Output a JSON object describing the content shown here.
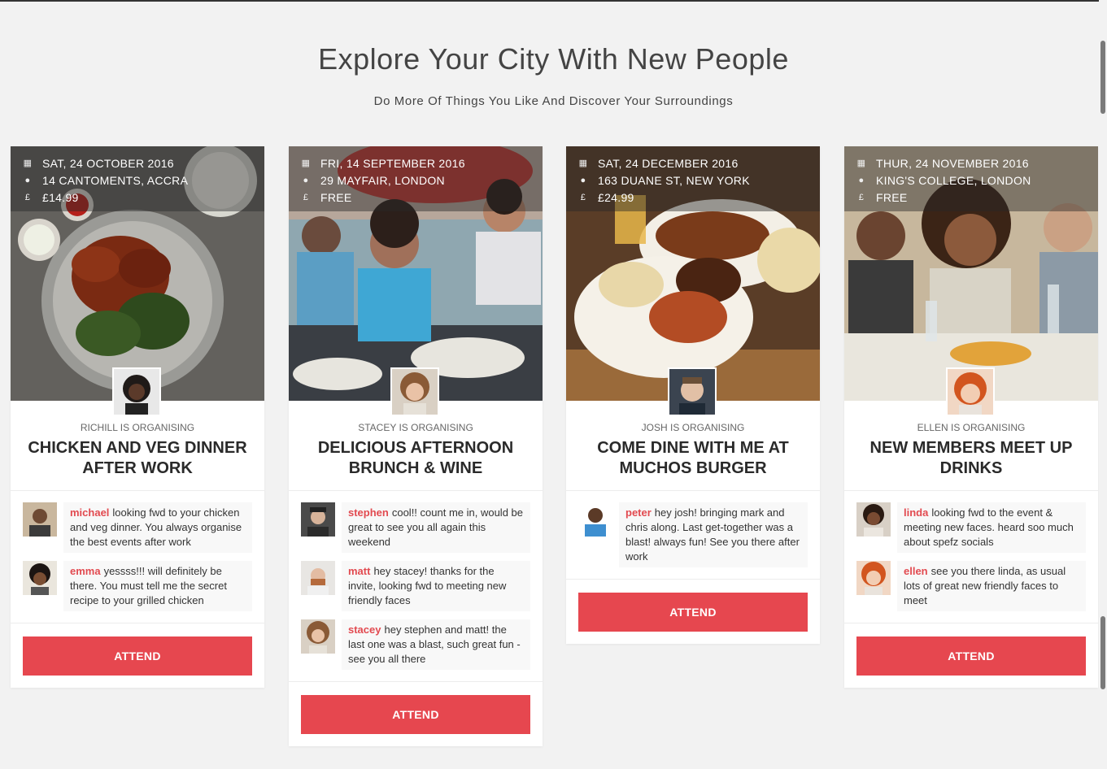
{
  "hero": {
    "title": "Explore Your City With New People",
    "subtitle": "Do More Of Things You Like And Discover Your Surroundings"
  },
  "colors": {
    "accent": "#e6474f",
    "commenter_name": "#e24a50"
  },
  "icons": {
    "date": "calendar-icon",
    "location": "map-pin-icon",
    "price": "pound-icon"
  },
  "events": [
    {
      "date": "SAT, 24 OCTOBER 2016",
      "location": "14 CANTOMENTS, ACCRA",
      "price": "£14.99",
      "organiser": "RICHILL IS ORGANISING",
      "title": "CHICKEN AND VEG DINNER AFTER WORK",
      "attend_label": "ATTEND",
      "comments": [
        {
          "name": "michael",
          "text": "looking fwd to your chicken and veg dinner. You always organise the best events after work"
        },
        {
          "name": "emma",
          "text": "yessss!!! will definitely be there. You must tell me the secret recipe to your grilled chicken"
        }
      ]
    },
    {
      "date": "FRI, 14 SEPTEMBER 2016",
      "location": "29 MAYFAIR, LONDON",
      "price": "FREE",
      "organiser": "STACEY IS ORGANISING",
      "title": "DELICIOUS AFTERNOON BRUNCH & WINE",
      "attend_label": "ATTEND",
      "comments": [
        {
          "name": "stephen",
          "text": "cool!! count me in, would be great to see you all again this weekend"
        },
        {
          "name": "matt",
          "text": "hey stacey! thanks for the invite, looking fwd to meeting new friendly faces"
        },
        {
          "name": "stacey",
          "text": "hey stephen and matt! the last one was a blast, such great fun - see you all there"
        }
      ]
    },
    {
      "date": "SAT, 24 DECEMBER 2016",
      "location": "163 DUANE ST, NEW YORK",
      "price": "£24.99",
      "organiser": "JOSH IS ORGANISING",
      "title": "COME DINE WITH ME AT MUCHOS BURGER",
      "attend_label": "ATTEND",
      "comments": [
        {
          "name": "peter",
          "text": "hey josh! bringing mark and chris along. Last get-together was a blast! always fun! See you there after work"
        }
      ]
    },
    {
      "date": "THUR, 24 NOVEMBER 2016",
      "location": "KING'S COLLEGE, LONDON",
      "price": "FREE",
      "organiser": "ELLEN IS ORGANISING",
      "title": "NEW MEMBERS MEET UP DRINKS",
      "attend_label": "ATTEND",
      "comments": [
        {
          "name": "linda",
          "text": "looking fwd to the event & meeting new faces. heard soo much about spefz socials"
        },
        {
          "name": "ellen",
          "text": "see you there linda, as usual lots of great new friendly faces to meet"
        }
      ]
    }
  ]
}
